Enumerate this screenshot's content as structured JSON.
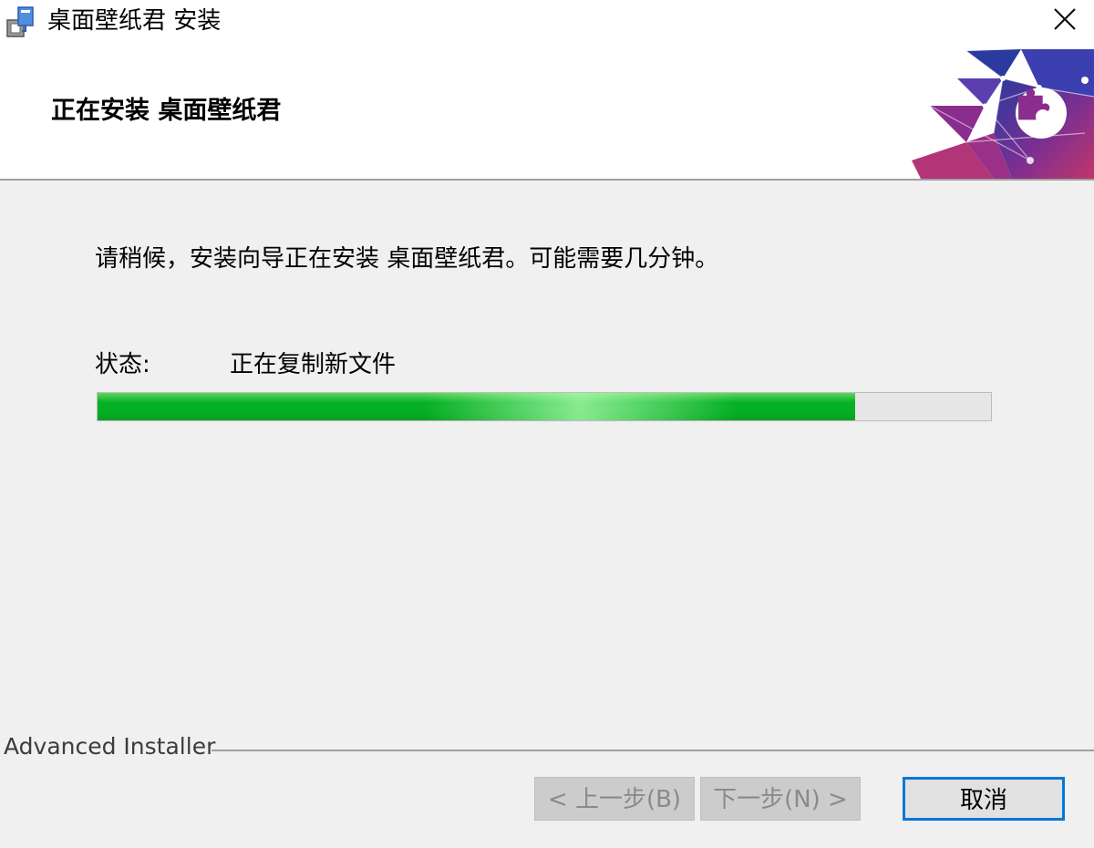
{
  "window": {
    "title": "桌面壁纸君 安装",
    "app_icon": "installer-icon",
    "close_icon": "close-icon"
  },
  "header": {
    "title": "正在安装 桌面壁纸君",
    "banner_icon": "puzzle-banner-icon"
  },
  "main": {
    "message": "请稍候，安装向导正在安装 桌面壁纸君。可能需要几分钟。",
    "status_label": "状态:",
    "status_value": "正在复制新文件",
    "progress": 0.848
  },
  "footer": {
    "brand": "Advanced Installer",
    "back_label": "< 上一步(B)",
    "next_label": "下一步(N) >",
    "cancel_label": "取消"
  },
  "colors": {
    "progress_fill": "#06b025",
    "focus_border": "#0078d7",
    "banner_blue": "#2a3a9e",
    "banner_purple": "#8a2d8f",
    "banner_magenta": "#c2356b"
  }
}
